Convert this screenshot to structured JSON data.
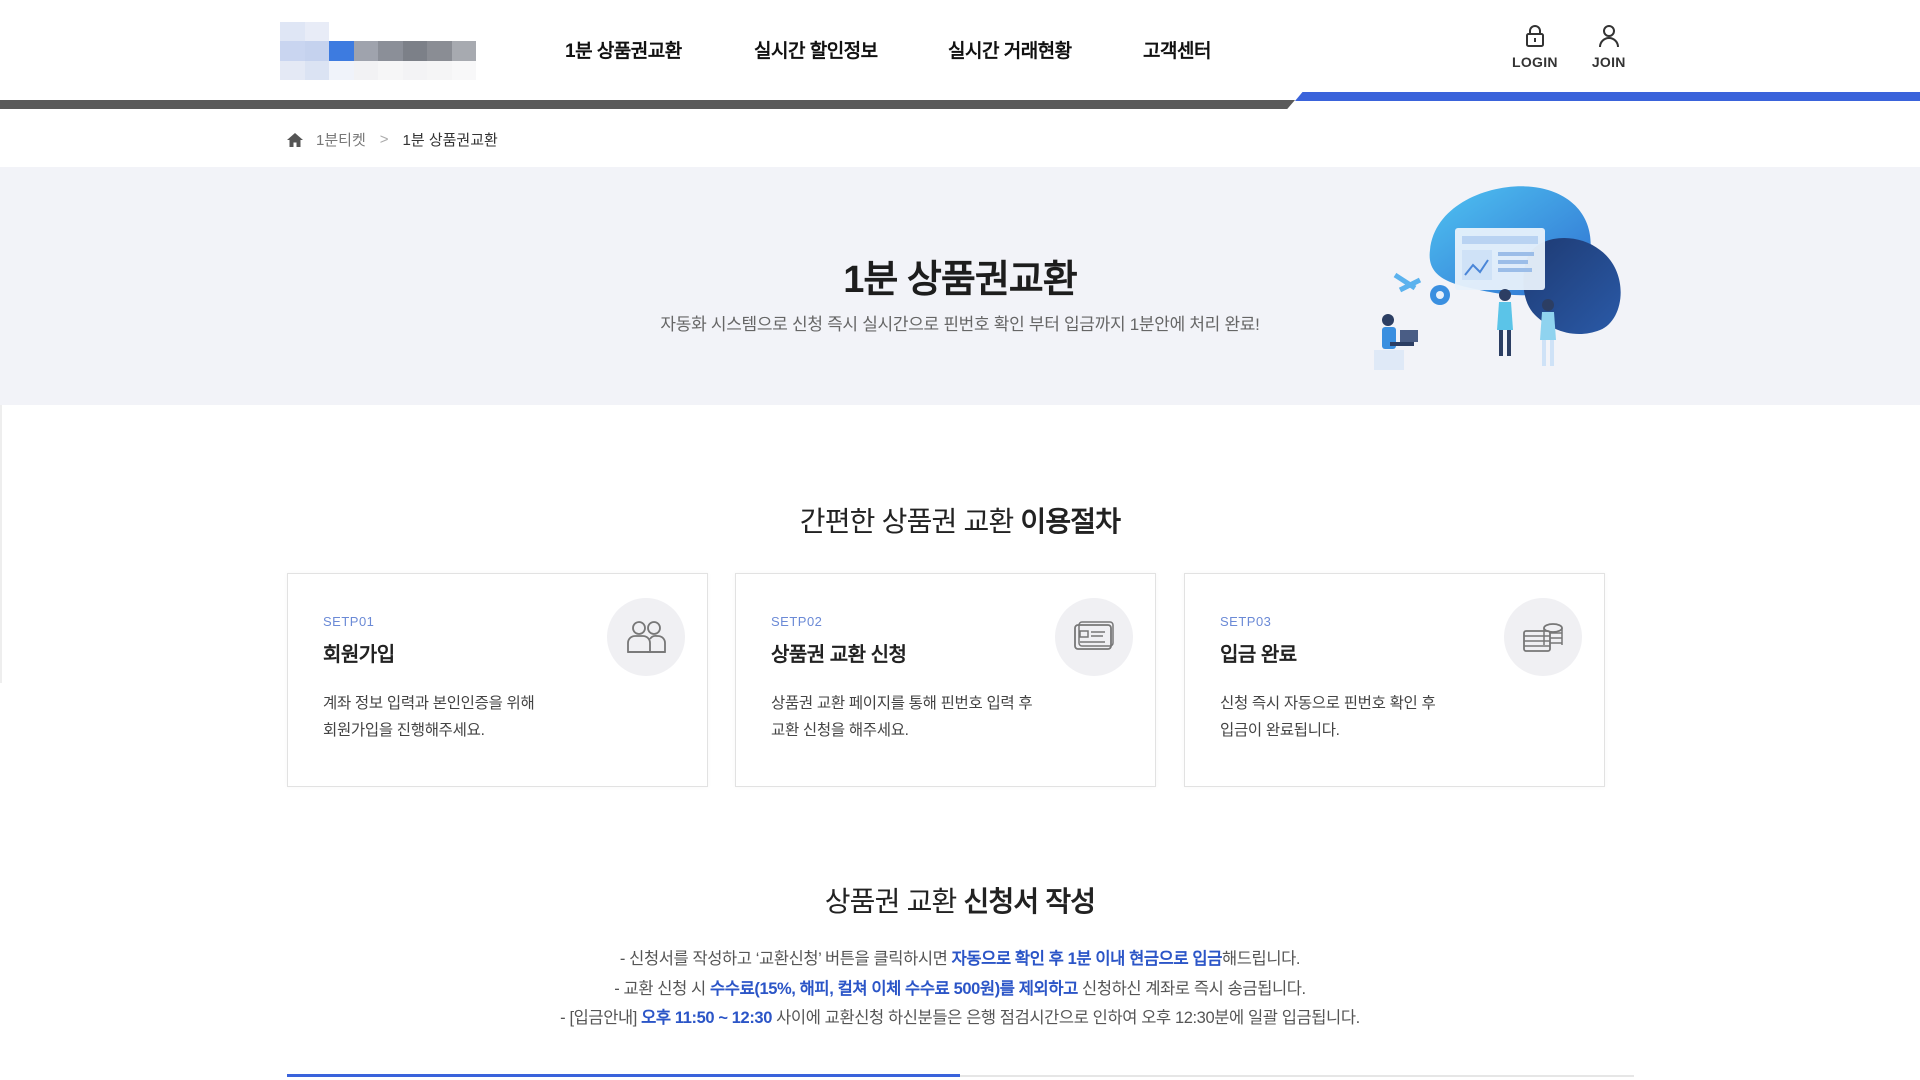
{
  "header": {
    "nav": [
      {
        "label": "1분 상품권교환"
      },
      {
        "label": "실시간 할인정보"
      },
      {
        "label": "실시간 거래현황"
      },
      {
        "label": "고객센터"
      }
    ],
    "login_label": "LOGIN",
    "join_label": "JOIN",
    "accent_color": "#3a63db"
  },
  "breadcrumb": {
    "home": "1분티켓",
    "separator": ">",
    "current": "1분 상품권교환"
  },
  "hero": {
    "title": "1분 상품권교환",
    "subtitle": "자동화 시스템으로 신청 즉시 실시간으로 핀번호 확인 부터 입금까지 1분안에 처리 완료!"
  },
  "process": {
    "title_normal": "간편한 상품권 교환 ",
    "title_bold": "이용절차",
    "steps": [
      {
        "step": "SETP01",
        "title": "회원가입",
        "desc_line1": "계좌 정보 입력과 본인인증을 위해",
        "desc_line2": "회원가입을 진행해주세요.",
        "icon": "users-icon"
      },
      {
        "step": "SETP02",
        "title": "상품권 교환 신청",
        "desc_line1": "상품권 교환 페이지를 통해 핀번호 입력 후",
        "desc_line2": "교환 신청을 해주세요.",
        "icon": "card-icon"
      },
      {
        "step": "SETP03",
        "title": "입금 완료",
        "desc_line1": "신청 즉시 자동으로 핀번호 확인 후",
        "desc_line2": "입금이 완료됩니다.",
        "icon": "coins-icon"
      }
    ]
  },
  "application": {
    "title_normal": "상품권 교환 ",
    "title_bold": "신청서 작성",
    "note1": {
      "pre": "- 신청서를 작성하고 ‘교환신청’ 버튼을 클릭하시면 ",
      "hl": "자동으로 확인 후 1분 이내 현금으로 입금",
      "post": "해드립니다."
    },
    "note2": {
      "pre": "- 교환 신청 시 ",
      "hl": "수수료(15%, 해피, 컬쳐 이체 수수료 500원)를 제외하고",
      "post": " 신청하신 계좌로 즉시 송금됩니다."
    },
    "note3": {
      "pre": "- [입금안내] ",
      "hl": "오후 11:50 ~ 12:30",
      "post": " 사이에 교환신청 하신분들은 은행 점검시간으로 인하여 오후 12:30분에 일괄 입금됩니다."
    }
  }
}
